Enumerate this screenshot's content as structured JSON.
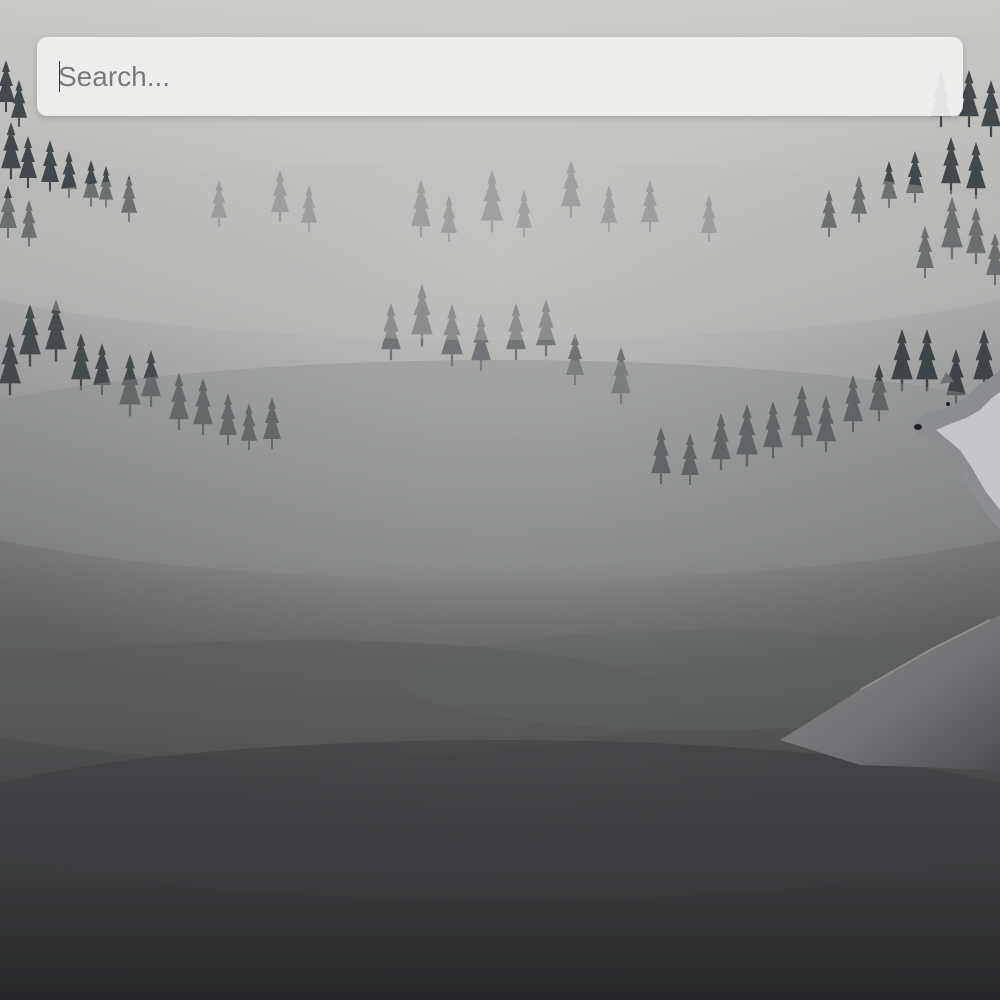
{
  "search": {
    "placeholder": "Search...",
    "value": ""
  },
  "wallpaper": {
    "subject": "wolf-on-snowy-ridge-above-foggy-forest"
  }
}
